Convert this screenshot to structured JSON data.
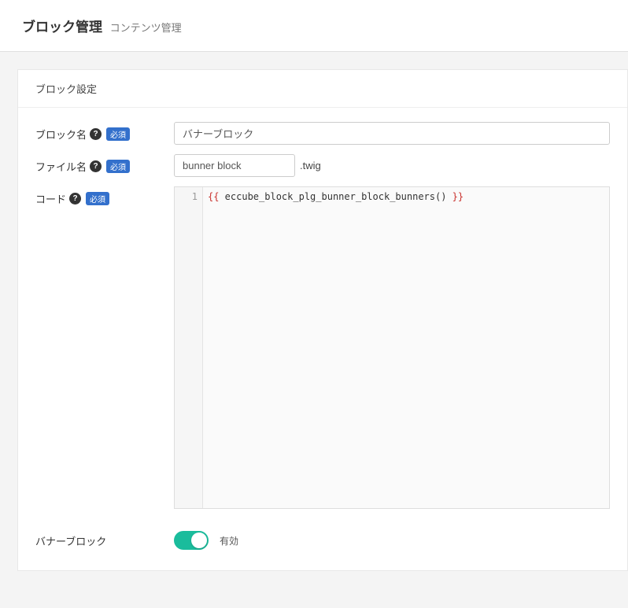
{
  "header": {
    "title": "ブロック管理",
    "subtitle": "コンテンツ管理"
  },
  "panel": {
    "title": "ブロック設定"
  },
  "fields": {
    "block_name": {
      "label": "ブロック名",
      "required": "必須",
      "value": "バナーブロック"
    },
    "file_name": {
      "label": "ファイル名",
      "required": "必須",
      "value": "bunner block",
      "extension": ".twig"
    },
    "code": {
      "label": "コード",
      "required": "必須",
      "line_number": "1",
      "brace_open": "{{",
      "content": " eccube_block_plg_bunner_block_bunners() ",
      "brace_close": "}}"
    }
  },
  "toggle": {
    "label": "バナーブロック",
    "status": "有効",
    "enabled": true
  }
}
